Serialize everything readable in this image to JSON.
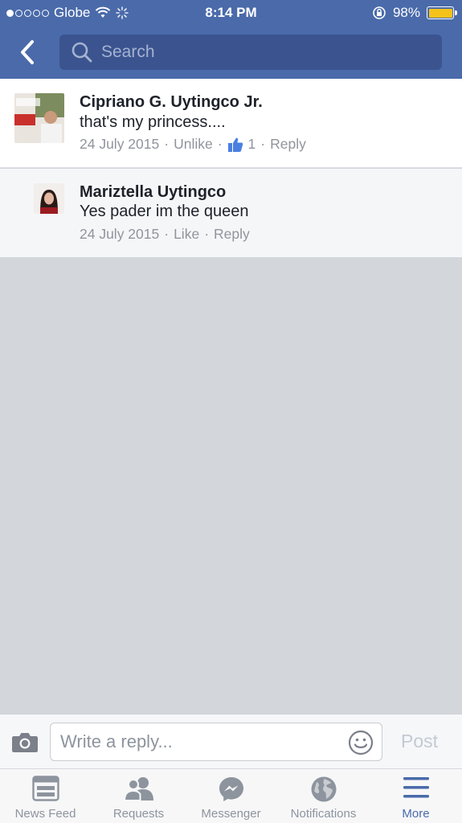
{
  "status_bar": {
    "carrier": "Globe",
    "time": "8:14 PM",
    "battery": "98%",
    "battery_color": "#f5c21a"
  },
  "header": {
    "search_placeholder": "Search",
    "bar_color": "#4a6aaa"
  },
  "comments": [
    {
      "author": "Cipriano G. Uytingco Jr.",
      "text": "that's my princess....",
      "date": "24 July 2015",
      "like_action": "Unlike",
      "like_count": "1",
      "reply_action": "Reply"
    },
    {
      "author": "Mariztella Uytingco",
      "text": "Yes pader im the queen",
      "date": "24 July 2015",
      "like_action": "Like",
      "reply_action": "Reply"
    }
  ],
  "composer": {
    "placeholder": "Write a reply...",
    "post_label": "Post"
  },
  "tabbar": {
    "tabs": [
      {
        "label": "News Feed",
        "icon": "news-feed-icon"
      },
      {
        "label": "Requests",
        "icon": "friend-requests-icon"
      },
      {
        "label": "Messenger",
        "icon": "messenger-icon"
      },
      {
        "label": "Notifications",
        "icon": "globe-icon"
      },
      {
        "label": "More",
        "icon": "menu-icon",
        "active": true
      }
    ],
    "active_color": "#4a6aaa"
  }
}
